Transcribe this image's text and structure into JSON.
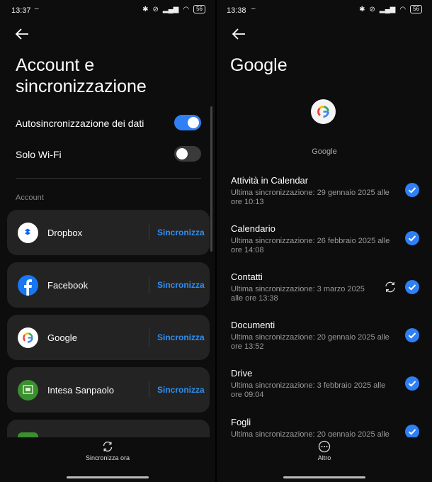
{
  "left": {
    "status": {
      "time": "13:37",
      "battery": "56"
    },
    "title_line1": "Account e",
    "title_line2": "sincronizzazione",
    "autosync": {
      "label": "Autosincronizzazione dei dati",
      "on": true
    },
    "wifi_only": {
      "label": "Solo Wi-Fi",
      "on": false
    },
    "section_label": "Account",
    "accounts": [
      {
        "name": "Dropbox",
        "action": "Sincronizza"
      },
      {
        "name": "Facebook",
        "action": "Sincronizza"
      },
      {
        "name": "Google",
        "action": "Sincronizza"
      },
      {
        "name": "Intesa Sanpaolo",
        "action": "Sincronizza"
      }
    ],
    "bottom_action": "Sincronizza ora",
    "colors": {
      "accent": "#2f8ff5",
      "toggle_on": "#2f7ff5",
      "toggle_off": "#3a3a3a"
    }
  },
  "right": {
    "status": {
      "time": "13:38",
      "battery": "56"
    },
    "title": "Google",
    "account_name": "Google",
    "items": [
      {
        "title": "Attività in Calendar",
        "sub": "Ultima sincronizzazione: 29 gennaio 2025 alle ore 10:13"
      },
      {
        "title": "Calendario",
        "sub": "Ultima sincronizzazione: 26 febbraio 2025 alle ore 14:08"
      },
      {
        "title": "Contatti",
        "sub": "Ultima sincronizzazione: 3 marzo 2025 alle ore 13:38"
      },
      {
        "title": "Documenti",
        "sub": "Ultima sincronizzazione: 20 gennaio 2025 alle ore 13:52"
      },
      {
        "title": "Drive",
        "sub": "Ultima sincronizzazione: 3 febbraio 2025 alle ore 09:04"
      },
      {
        "title": "Fogli",
        "sub": "Ultima sincronizzazione: 20 gennaio 2025 alle"
      }
    ],
    "bottom_action": "Altro"
  }
}
